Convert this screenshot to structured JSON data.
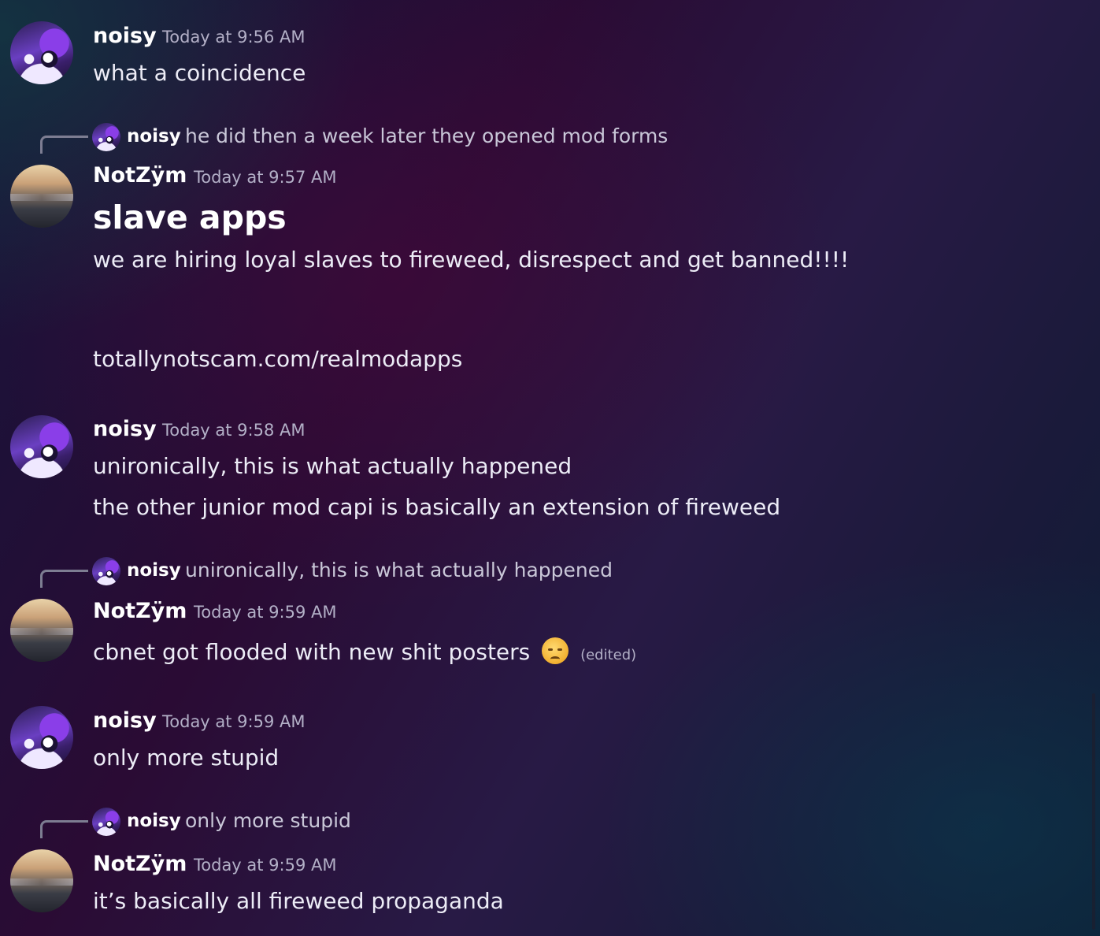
{
  "messages": [
    {
      "author": "noisy",
      "timestamp": "Today at 9:56 AM",
      "lines": [
        "what a coincidence"
      ]
    },
    {
      "reply_to": {
        "author": "noisy",
        "text": "he did  then a week later they opened mod forms"
      },
      "author": "NotZÿm",
      "timestamp": "Today at 9:57 AM",
      "heading": "slave apps",
      "lines": [
        "we are hiring loyal slaves to fireweed, disrespect and get banned!!!!",
        "totallynotscam.com/realmodapps"
      ]
    },
    {
      "author": "noisy",
      "timestamp": "Today at 9:58 AM",
      "lines": [
        "unironically, this is what actually happened",
        "the other junior mod capi is basically an extension of fireweed"
      ]
    },
    {
      "reply_to": {
        "author": "noisy",
        "text": "unironically, this is what actually happened"
      },
      "author": "NotZÿm",
      "timestamp": "Today at 9:59 AM",
      "lines": [
        "cbnet got flooded with new shit posters"
      ],
      "emoji": "pensive-face",
      "edited": "(edited)"
    },
    {
      "author": "noisy",
      "timestamp": "Today at 9:59 AM",
      "lines": [
        "only more stupid"
      ]
    },
    {
      "reply_to": {
        "author": "noisy",
        "text": "only more stupid"
      },
      "author": "NotZÿm",
      "timestamp": "Today at 9:59 AM",
      "lines": [
        "it’s basically all fireweed propaganda"
      ]
    }
  ]
}
